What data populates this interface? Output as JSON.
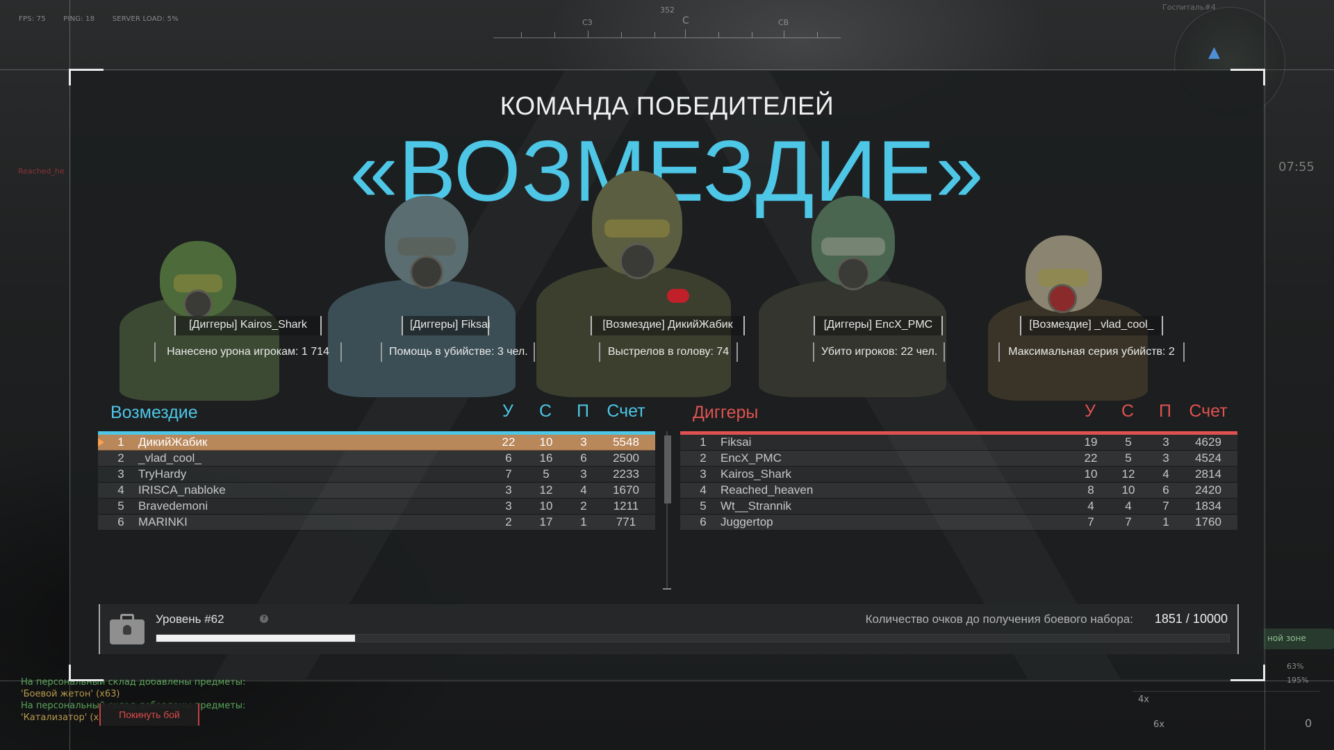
{
  "hud": {
    "fps": "FPS: 75",
    "ping": "PING: 18",
    "server_load": "SERVER LOAD: 5%",
    "compass_heading": "352",
    "compass_labels": [
      "СЗ",
      "С",
      "СВ"
    ],
    "map_name": "Госпиталь#4",
    "clock": "07:55",
    "killfeed_fragment": "Reached_he",
    "zone_label": "ной зоне",
    "percent_1": "63%",
    "percent_2": "195%",
    "scope_1": "4x",
    "scope_2": "6x",
    "ammo": "0"
  },
  "winner": {
    "subtitle": "КОМАНДА ПОБЕДИТЕЛЕЙ",
    "team": "«ВОЗМЕЗДИЕ»",
    "team_color": "#4ec6e6"
  },
  "highlights": [
    {
      "name": "[Диггеры] Kairos_Shark",
      "stat": "Нанесено урона игрокам: 1 714"
    },
    {
      "name": "[Диггеры] Fiksai",
      "stat": "Помощь в убийстве: 3 чел."
    },
    {
      "name": "[Возмездие] ДикийЖабик",
      "stat": "Выстрелов в голову: 74"
    },
    {
      "name": "[Диггеры] EncX_PMC",
      "stat": "Убито игроков: 22 чел."
    },
    {
      "name": "[Возмездие] _vlad_cool_",
      "stat": "Максимальная серия убийств: 2"
    }
  ],
  "columns": {
    "kills": "У",
    "deaths": "С",
    "assists": "П",
    "score": "Счет"
  },
  "team_left": {
    "name": "Возмездие",
    "color": "#4ec6e6",
    "rows": [
      {
        "rank": "1",
        "name": "ДикийЖабик",
        "k": "22",
        "d": "10",
        "a": "3",
        "score": "5548"
      },
      {
        "rank": "2",
        "name": "_vlad_cool_",
        "k": "6",
        "d": "16",
        "a": "6",
        "score": "2500"
      },
      {
        "rank": "3",
        "name": "TryHardy",
        "k": "7",
        "d": "5",
        "a": "3",
        "score": "2233"
      },
      {
        "rank": "4",
        "name": "IRISCA_nabloke",
        "k": "3",
        "d": "12",
        "a": "4",
        "score": "1670"
      },
      {
        "rank": "5",
        "name": "Bravedemoni",
        "k": "3",
        "d": "10",
        "a": "2",
        "score": "1211"
      },
      {
        "rank": "6",
        "name": "MARINKI",
        "k": "2",
        "d": "17",
        "a": "1",
        "score": "771"
      }
    ]
  },
  "team_right": {
    "name": "Диггеры",
    "color": "#e05252",
    "rows": [
      {
        "rank": "1",
        "name": "Fiksai",
        "k": "19",
        "d": "5",
        "a": "3",
        "score": "4629"
      },
      {
        "rank": "2",
        "name": "EncX_PMC",
        "k": "22",
        "d": "5",
        "a": "3",
        "score": "4524"
      },
      {
        "rank": "3",
        "name": "Kairos_Shark",
        "k": "10",
        "d": "12",
        "a": "4",
        "score": "2814"
      },
      {
        "rank": "4",
        "name": "Reached_heaven",
        "k": "8",
        "d": "10",
        "a": "6",
        "score": "2420"
      },
      {
        "rank": "5",
        "name": "Wt__Strannik",
        "k": "4",
        "d": "4",
        "a": "7",
        "score": "1834"
      },
      {
        "rank": "6",
        "name": "Juggertop",
        "k": "7",
        "d": "7",
        "a": "1",
        "score": "1760"
      }
    ]
  },
  "level": {
    "label": "Уровень #62",
    "points_label": "Количество очков до получения боевого набора:",
    "points_value": "1851 / 10000",
    "progress": 0.1851
  },
  "chat": [
    "На персональный склад добавлены предметы:",
    "'Боевой жетон' (x63)",
    "На персональный склад добавлены предметы:",
    "'Катализатор' (x"
  ],
  "leave_button": "Покинуть бой"
}
